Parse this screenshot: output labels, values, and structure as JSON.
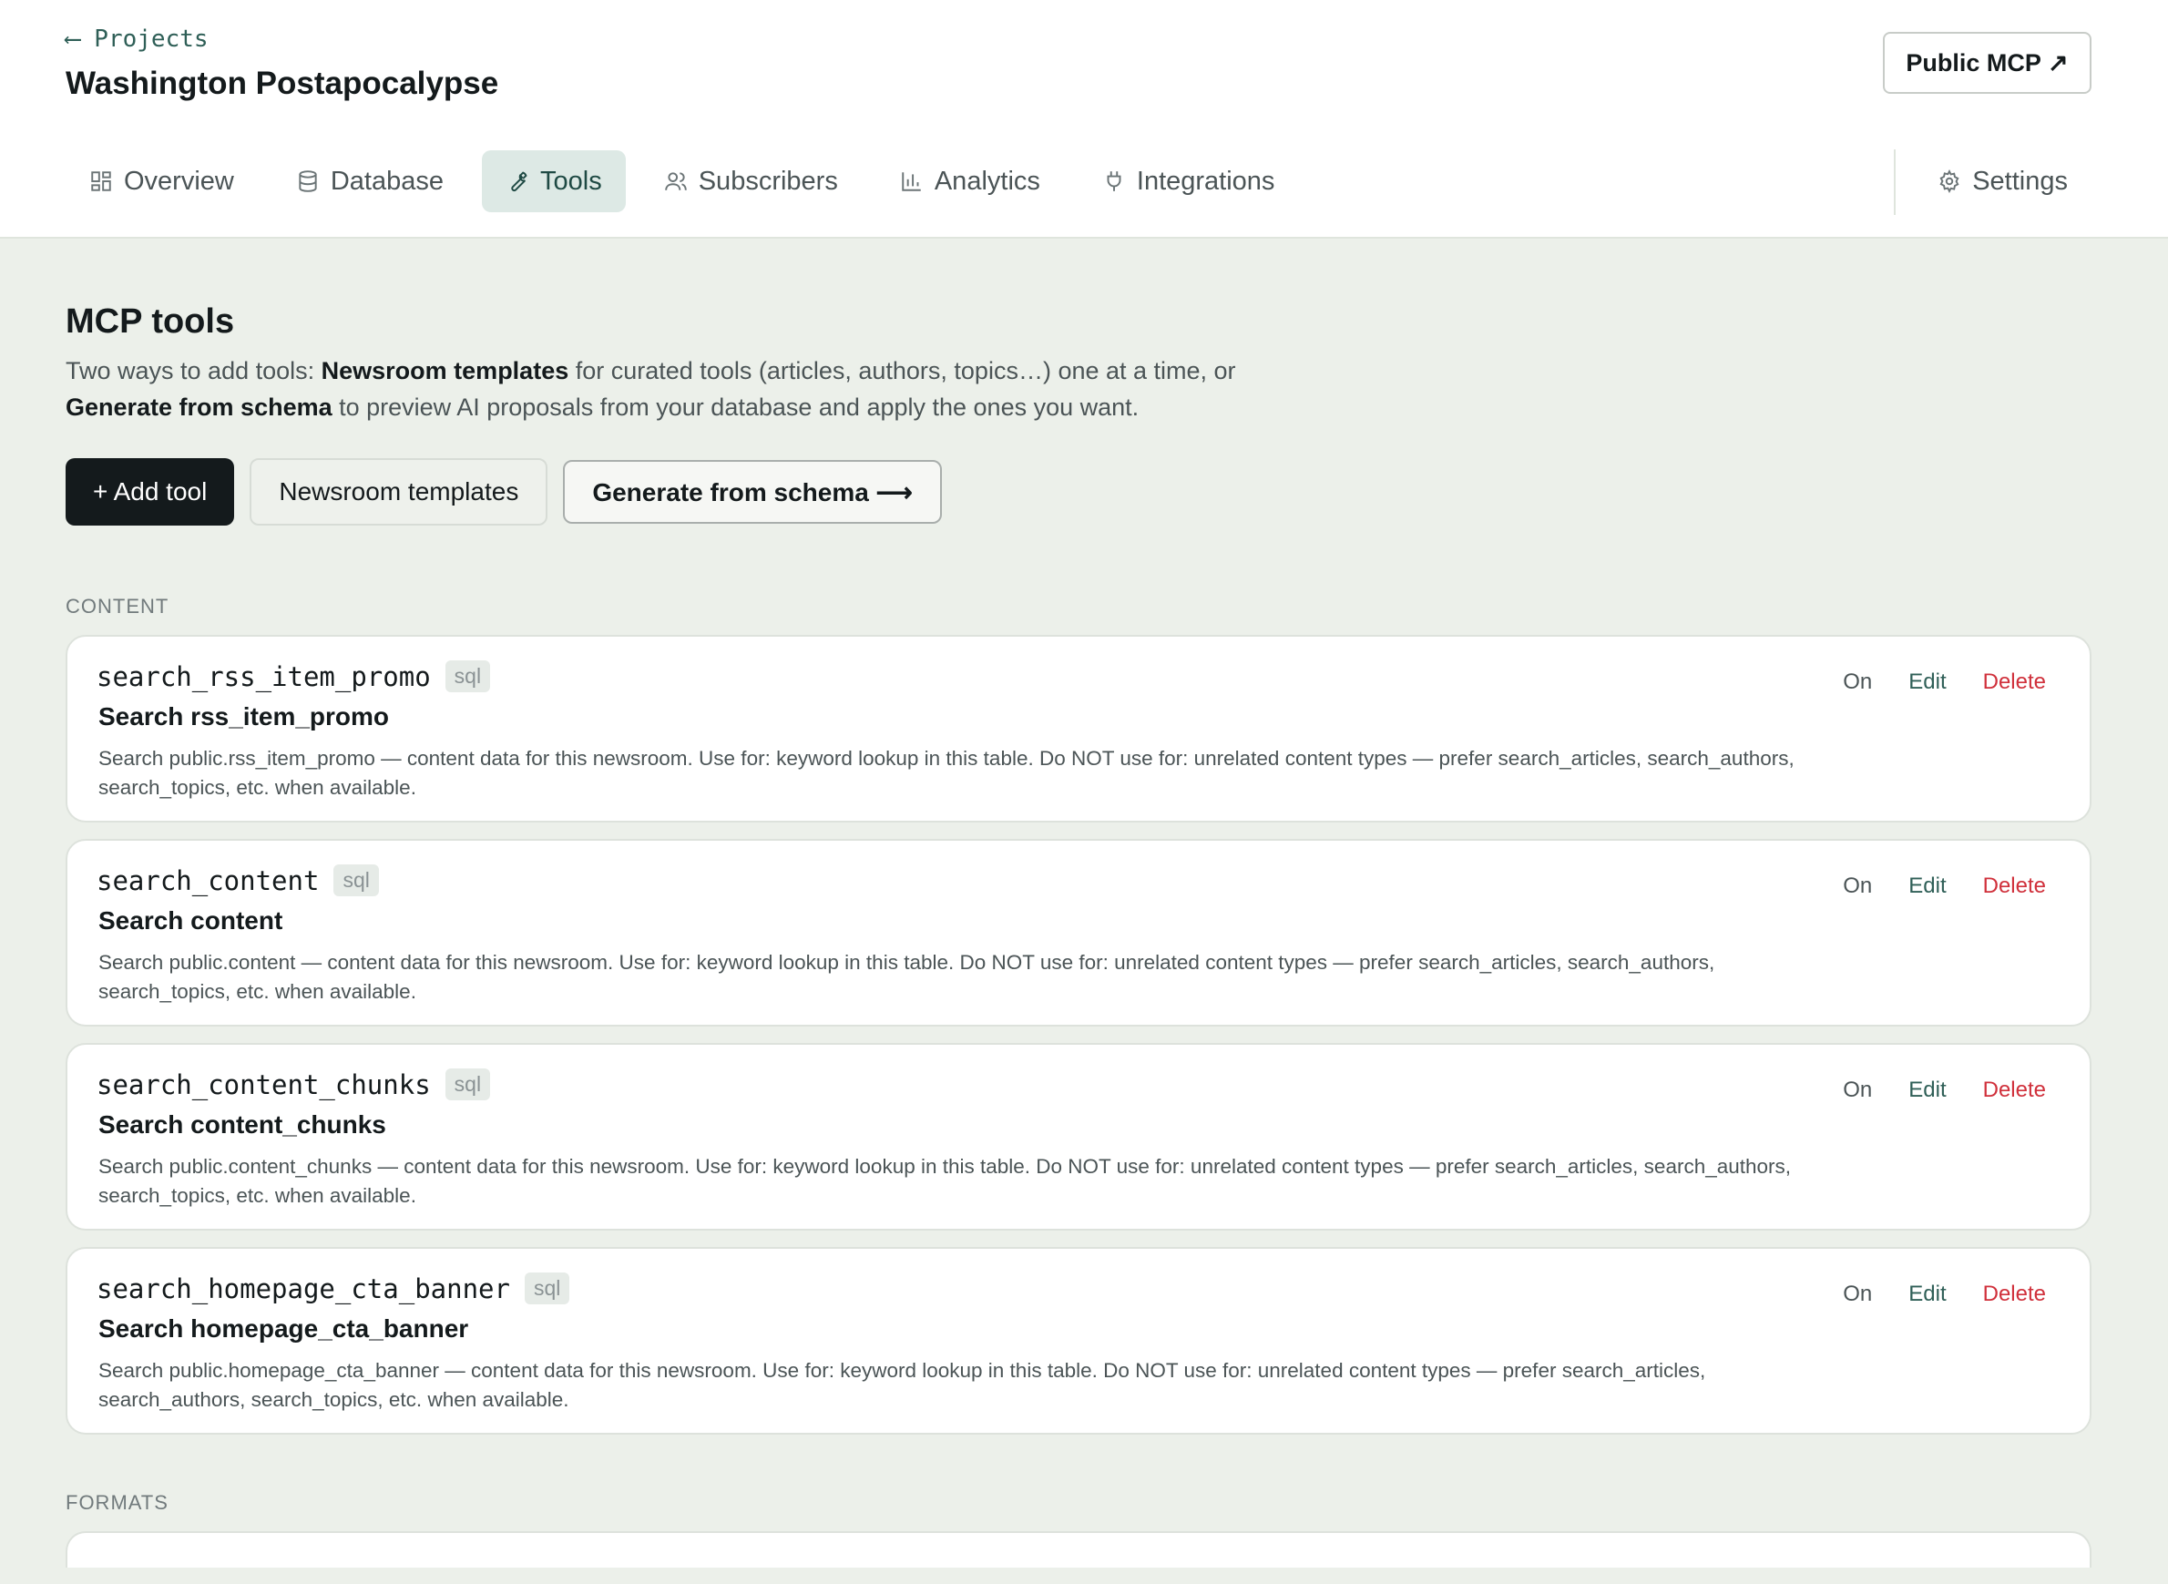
{
  "header": {
    "back_label": "⟵ Projects",
    "project_title": "Washington Postapocalypse",
    "public_button": "Public MCP ↗"
  },
  "tabs": [
    {
      "label": "Overview",
      "icon": "grid-icon",
      "active": false
    },
    {
      "label": "Database",
      "icon": "database-icon",
      "active": false
    },
    {
      "label": "Tools",
      "icon": "wrench-icon",
      "active": true
    },
    {
      "label": "Subscribers",
      "icon": "users-icon",
      "active": false
    },
    {
      "label": "Analytics",
      "icon": "bar-chart-icon",
      "active": false
    },
    {
      "label": "Integrations",
      "icon": "plug-icon",
      "active": false
    }
  ],
  "settings_tab": {
    "label": "Settings",
    "icon": "gear-icon"
  },
  "main": {
    "title": "MCP tools",
    "desc": {
      "p1": "Two ways to add tools: ",
      "b1": "Newsroom templates",
      "p2": " for curated tools (articles, authors, topics…) one at a time, or ",
      "b2": "Generate from schema",
      "p3": " to preview AI proposals from your database and apply the ones you want."
    },
    "buttons": {
      "add": "+ Add tool",
      "templates": "Newsroom templates",
      "generate": "Generate from schema ⟶"
    }
  },
  "groups": [
    {
      "label": "CONTENT",
      "tools": [
        {
          "name": "search_rss_item_promo",
          "kind": "sql",
          "title": "Search rss_item_promo",
          "desc": "Search public.rss_item_promo — content data for this newsroom. Use for: keyword lookup in this table. Do NOT use for: unrelated content types — prefer search_articles, search_authors, search_topics, etc. when available."
        },
        {
          "name": "search_content",
          "kind": "sql",
          "title": "Search content",
          "desc": "Search public.content — content data for this newsroom. Use for: keyword lookup in this table. Do NOT use for: unrelated content types — prefer search_articles, search_authors, search_topics, etc. when available."
        },
        {
          "name": "search_content_chunks",
          "kind": "sql",
          "title": "Search content_chunks",
          "desc": "Search public.content_chunks — content data for this newsroom. Use for: keyword lookup in this table. Do NOT use for: unrelated content types — prefer search_articles, search_authors, search_topics, etc. when available."
        },
        {
          "name": "search_homepage_cta_banner",
          "kind": "sql",
          "title": "Search homepage_cta_banner",
          "desc": "Search public.homepage_cta_banner — content data for this newsroom. Use for: keyword lookup in this table. Do NOT use for: unrelated content types — prefer search_articles, search_authors, search_topics, etc. when available."
        }
      ]
    },
    {
      "label": "FORMATS",
      "tools": []
    }
  ],
  "tool_actions": {
    "on": "On",
    "edit": "Edit",
    "delete": "Delete"
  }
}
